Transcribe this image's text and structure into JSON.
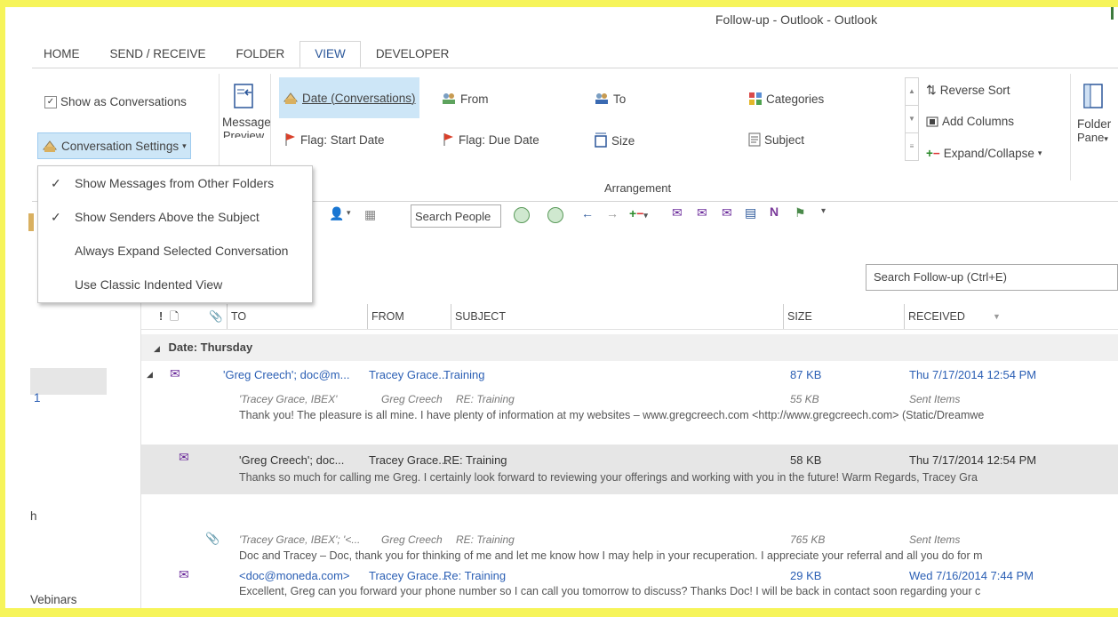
{
  "window": {
    "title": "Follow-up - Outlook - Outlook"
  },
  "tabs": [
    "HOME",
    "SEND / RECEIVE",
    "FOLDER",
    "VIEW",
    "DEVELOPER"
  ],
  "ribbon": {
    "show_as_conversations": "Show as Conversations",
    "conversation_settings": "Conversation Settings",
    "message_preview": "Message",
    "message_preview_sub": "Preview",
    "arrangement_label": "Arrangement",
    "arr_date": "Date (Conversations)",
    "arr_from": "From",
    "arr_to": "To",
    "arr_categories": "Categories",
    "arr_flag_start": "Flag: Start Date",
    "arr_flag_due": "Flag: Due Date",
    "arr_size": "Size",
    "arr_subject": "Subject",
    "reverse_sort": "Reverse Sort",
    "add_columns": "Add Columns",
    "expand_collapse": "Expand/Collapse",
    "folder_pane": "Folder",
    "folder_pane_sub": "Pane"
  },
  "dropdown": [
    {
      "label": "Show Messages from Other Folders",
      "checked": true
    },
    {
      "label": "Show Senders Above the Subject",
      "checked": true
    },
    {
      "label": "Always Expand Selected Conversation",
      "checked": false
    },
    {
      "label": "Use Classic Indented View",
      "checked": false
    }
  ],
  "toolbar": {
    "search_people": "Search People"
  },
  "search": {
    "placeholder": "Search Follow-up (Ctrl+E)"
  },
  "columns": {
    "to": "TO",
    "from": "FROM",
    "subject": "SUBJECT",
    "size": "SIZE",
    "received": "RECEIVED"
  },
  "group_header": "Date: Thursday",
  "nav": {
    "count": "1",
    "item_h": "h",
    "item_webinars": "Vebinars"
  },
  "messages": [
    {
      "to": "'Greg Creech'; doc@m...",
      "from": "Tracey Grace...",
      "subject": "Training",
      "size": "87 KB",
      "received": "Thu 7/17/2014 12:54 PM"
    },
    {
      "to": "'Tracey Grace, IBEX'",
      "from": "Greg Creech",
      "subject": "RE: Training",
      "size": "55 KB",
      "received": "Sent Items",
      "preview": "Thank you! The pleasure is all mine. I have plenty of information at my websites – www.gregcreech.com <http://www.gregcreech.com> (Static/Dreamwe"
    },
    {
      "to": "'Greg Creech'; doc...",
      "from": "Tracey Grace...",
      "subject": "RE: Training",
      "size": "58 KB",
      "received": "Thu 7/17/2014 12:54 PM",
      "preview": "Thanks so much for calling me Greg.  I certainly look forward to reviewing your offerings and working with you in the future!  Warm Regards,  Tracey Gra"
    },
    {
      "to": "'Tracey Grace, IBEX'; '<...",
      "from": "Greg Creech",
      "subject": "RE: Training",
      "size": "765 KB",
      "received": "Sent Items",
      "preview": "Doc and Tracey –  Doc, thank you for thinking of me and let me know how I may help in your recuperation. I appreciate your referral and all you do for m"
    },
    {
      "to": "<doc@moneda.com>",
      "from": "Tracey Grace...",
      "subject": "Re: Training",
      "size": "29 KB",
      "received": "Wed 7/16/2014 7:44 PM",
      "preview": "Excellent,  Greg can you forward your phone number so I can call you tomorrow to discuss?  Thanks Doc!  I will be back in contact soon regarding your c"
    }
  ],
  "colors": {
    "accent": "#2b579a",
    "link": "#2b5fb4",
    "selected_row": "#e6e6e6",
    "hover_arr": "#cde6f7",
    "frame": "#f6f45a"
  }
}
